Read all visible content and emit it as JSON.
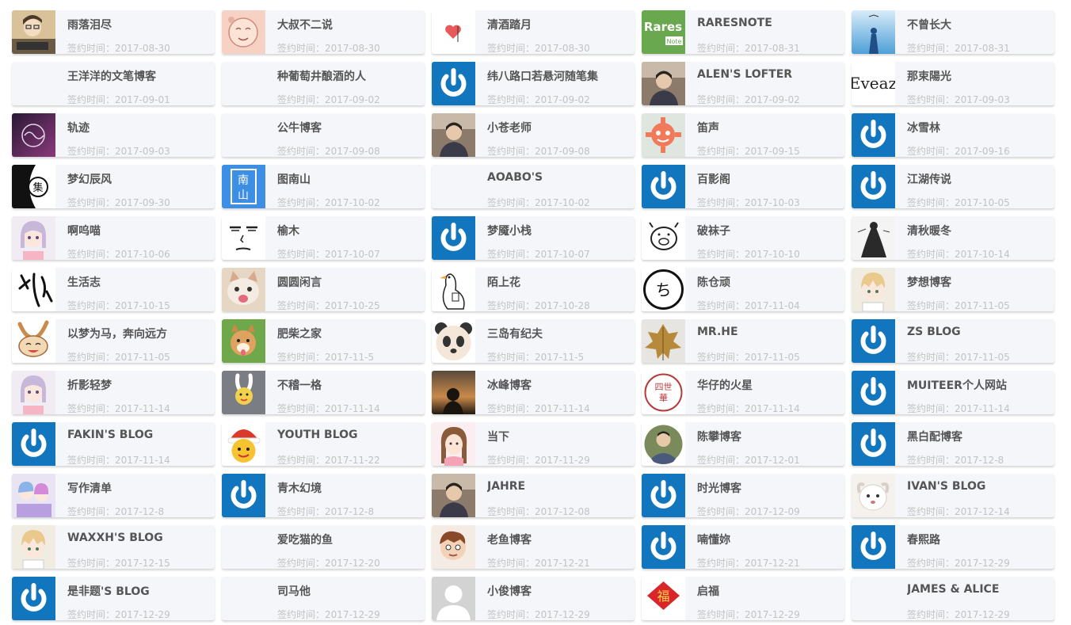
{
  "date_prefix": "签约时间：",
  "colors": {
    "card_bg": "#f4f6fa",
    "name": "#555555",
    "date": "#c2c2c2",
    "default_avatar": "#1176bd"
  },
  "friends": [
    {
      "name": "雨落泪尽",
      "date": "2017-08-30",
      "avatar": "cartoon-person-icon"
    },
    {
      "name": "大叔不二说",
      "date": "2017-08-30",
      "avatar": "anime-face-icon"
    },
    {
      "name": "清酒踏月",
      "date": "2017-08-30",
      "avatar": "heart-sketch-icon"
    },
    {
      "name": "RARESNOTE",
      "date": "2017-08-31",
      "avatar": "rares-note-logo"
    },
    {
      "name": "不曾长大",
      "date": "2017-08-31",
      "avatar": "sky-figure-icon"
    },
    {
      "name": "王洋洋的文笔博客",
      "date": "2017-09-01",
      "avatar": "blank-avatar"
    },
    {
      "name": "种葡萄井酿酒的人",
      "date": "2017-09-02",
      "avatar": "blank-avatar"
    },
    {
      "name": "纬八路口若悬河随笔集",
      "date": "2017-09-02",
      "avatar": "default-power-icon"
    },
    {
      "name": "ALEN'S LOFTER",
      "date": "2017-09-02",
      "avatar": "photo-person-icon"
    },
    {
      "name": "那束陽光",
      "date": "2017-09-03",
      "avatar": "eveaz-logo"
    },
    {
      "name": "轨迹",
      "date": "2017-09-03",
      "avatar": "dark-logo-icon"
    },
    {
      "name": "公牛博客",
      "date": "2017-09-08",
      "avatar": "blank-avatar"
    },
    {
      "name": "小苍老师",
      "date": "2017-09-08",
      "avatar": "photo-person-icon"
    },
    {
      "name": "笛声",
      "date": "2017-09-15",
      "avatar": "gear-face-icon"
    },
    {
      "name": "冰雪林",
      "date": "2017-09-16",
      "avatar": "default-power-icon"
    },
    {
      "name": "梦幻辰风",
      "date": "2017-09-30",
      "avatar": "black-white-logo"
    },
    {
      "name": "图南山",
      "date": "2017-10-02",
      "avatar": "blue-seal-icon"
    },
    {
      "name": "AOABO'S",
      "date": "2017-10-02",
      "avatar": "blank-avatar"
    },
    {
      "name": "百影阁",
      "date": "2017-10-03",
      "avatar": "default-power-icon"
    },
    {
      "name": "江湖传说",
      "date": "2017-10-05",
      "avatar": "default-power-icon"
    },
    {
      "name": "啊呜喵",
      "date": "2017-10-06",
      "avatar": "anime-girl-icon"
    },
    {
      "name": "榆木",
      "date": "2017-10-07",
      "avatar": "meme-face-icon"
    },
    {
      "name": "梦魇小栈",
      "date": "2017-10-07",
      "avatar": "default-power-icon"
    },
    {
      "name": "破袜子",
      "date": "2017-10-10",
      "avatar": "pig-sketch-icon"
    },
    {
      "name": "清秋暖冬",
      "date": "2017-10-14",
      "avatar": "ink-figure-icon"
    },
    {
      "name": "生活志",
      "date": "2017-10-15",
      "avatar": "calligraphy-icon"
    },
    {
      "name": "圆圆闲言",
      "date": "2017-10-25",
      "avatar": "cat-photo-icon"
    },
    {
      "name": "陌上花",
      "date": "2017-10-28",
      "avatar": "goose-sketch-icon"
    },
    {
      "name": "陈仓顽",
      "date": "2017-11-04",
      "avatar": "circle-logo-icon"
    },
    {
      "name": "梦想博客",
      "date": "2017-11-05",
      "avatar": "anime-boy-icon"
    },
    {
      "name": "以梦为马，奔向远方",
      "date": "2017-11-05",
      "avatar": "rabbit-cartoon-icon"
    },
    {
      "name": "肥柴之家",
      "date": "2017-11-5",
      "avatar": "dog-photo-icon"
    },
    {
      "name": "三岛有纪夫",
      "date": "2017-11-5",
      "avatar": "panda-icon"
    },
    {
      "name": "MR.HE",
      "date": "2017-11-05",
      "avatar": "leaf-icon"
    },
    {
      "name": "ZS BLOG",
      "date": "2017-11-05",
      "avatar": "default-power-icon"
    },
    {
      "name": "折影轻梦",
      "date": "2017-11-14",
      "avatar": "anime-girl-icon"
    },
    {
      "name": "不稽一格",
      "date": "2017-11-14",
      "avatar": "rabbit-toy-icon"
    },
    {
      "name": "冰峰博客",
      "date": "2017-11-14",
      "avatar": "sunset-silhouette-icon"
    },
    {
      "name": "华仔的火星",
      "date": "2017-11-14",
      "avatar": "red-seal-icon"
    },
    {
      "name": "MUITEER个人网站",
      "date": "2017-11-14",
      "avatar": "default-power-icon"
    },
    {
      "name": "FAKIN'S BLOG",
      "date": "2017-11-14",
      "avatar": "default-power-icon"
    },
    {
      "name": "YOUTH BLOG",
      "date": "2017-11-22",
      "avatar": "santa-cartoon-icon"
    },
    {
      "name": "当下",
      "date": "2017-11-29",
      "avatar": "drawn-girl-icon"
    },
    {
      "name": "陈攀博客",
      "date": "2017-12-01",
      "avatar": "circle-photo-icon"
    },
    {
      "name": "黑白配博客",
      "date": "2017-12-8",
      "avatar": "default-power-icon"
    },
    {
      "name": "写作清单",
      "date": "2017-12-8",
      "avatar": "anime-group-icon"
    },
    {
      "name": "青木幻境",
      "date": "2017-12-8",
      "avatar": "default-power-icon"
    },
    {
      "name": "JAHRE",
      "date": "2017-12-08",
      "avatar": "photo-person-icon"
    },
    {
      "name": "时光博客",
      "date": "2017-12-09",
      "avatar": "default-power-icon"
    },
    {
      "name": "IVAN'S BLOG",
      "date": "2017-12-14",
      "avatar": "white-dog-icon"
    },
    {
      "name": "WAXXH'S BLOG",
      "date": "2017-12-15",
      "avatar": "anime-boy-icon"
    },
    {
      "name": "爱吃猫的鱼",
      "date": "2017-12-20",
      "avatar": "blank-avatar"
    },
    {
      "name": "老鱼博客",
      "date": "2017-12-21",
      "avatar": "cartoon-face-icon"
    },
    {
      "name": "喃懂妳",
      "date": "2017-12-21",
      "avatar": "default-power-icon"
    },
    {
      "name": "春熙路",
      "date": "2017-12-29",
      "avatar": "default-power-icon"
    },
    {
      "name": "是非题'S BLOG",
      "date": "2017-12-29",
      "avatar": "default-power-icon"
    },
    {
      "name": "司马他",
      "date": "2017-12-29",
      "avatar": "blank-avatar"
    },
    {
      "name": "小俊博客",
      "date": "2017-12-29",
      "avatar": "generic-user-icon"
    },
    {
      "name": "启福",
      "date": "2017-12-29",
      "avatar": "red-fu-icon"
    },
    {
      "name": "JAMES & ALICE",
      "date": "2017-12-29",
      "avatar": "blank-avatar"
    }
  ]
}
